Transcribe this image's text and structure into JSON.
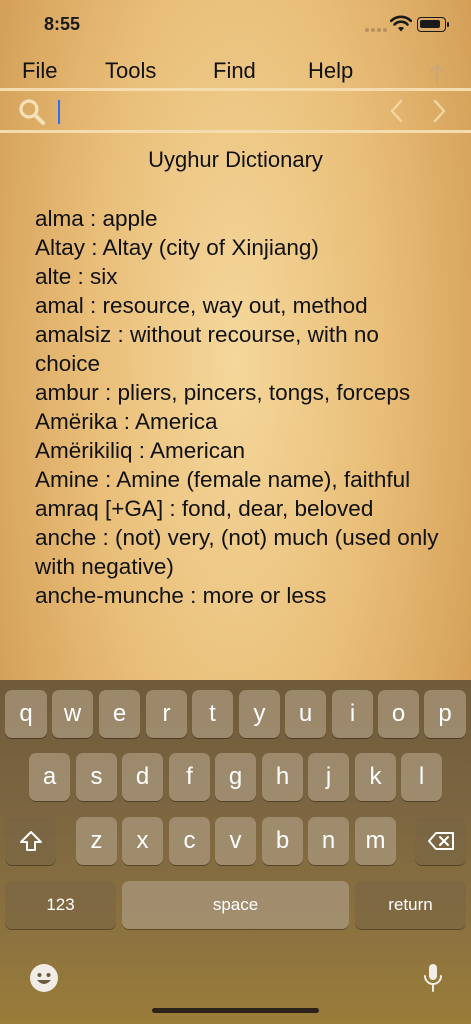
{
  "status": {
    "time": "8:55"
  },
  "menu": {
    "file": "File",
    "tools": "Tools",
    "find": "Find",
    "help": "Help"
  },
  "search": {
    "value": "",
    "placeholder": ""
  },
  "content": {
    "title": "Uyghur Dictionary",
    "entries": [
      "alma : apple",
      "Altay : Altay (city of Xinjiang)",
      "alte : six",
      "amal : resource, way out, method",
      "amalsiz : without recourse, with no choice",
      "ambur : pliers, pincers, tongs, forceps",
      "Amërika : America",
      "Amërikiliq : American",
      "Amine : Amine (female name), faithful",
      "amraq [+GA] : fond, dear, beloved",
      "anche : (not) very, (not) much (used only with negative)",
      "anche-munche : more or less"
    ]
  },
  "keyboard": {
    "row1": [
      "q",
      "w",
      "e",
      "r",
      "t",
      "y",
      "u",
      "i",
      "o",
      "p"
    ],
    "row2": [
      "a",
      "s",
      "d",
      "f",
      "g",
      "h",
      "j",
      "k",
      "l"
    ],
    "row3": [
      "z",
      "x",
      "c",
      "v",
      "b",
      "n",
      "m"
    ],
    "numbers": "123",
    "space": "space",
    "return": "return"
  },
  "icons": {
    "search": "search-icon",
    "prev": "chevron-left-icon",
    "next": "chevron-right-icon",
    "up": "arrow-up-icon",
    "shift": "shift-icon",
    "delete": "backspace-icon",
    "emoji": "emoji-icon",
    "mic": "microphone-icon"
  },
  "colors": {
    "accent": "#2f6bff",
    "divider": "#f4dcae",
    "muted_icon": "#caa677"
  }
}
